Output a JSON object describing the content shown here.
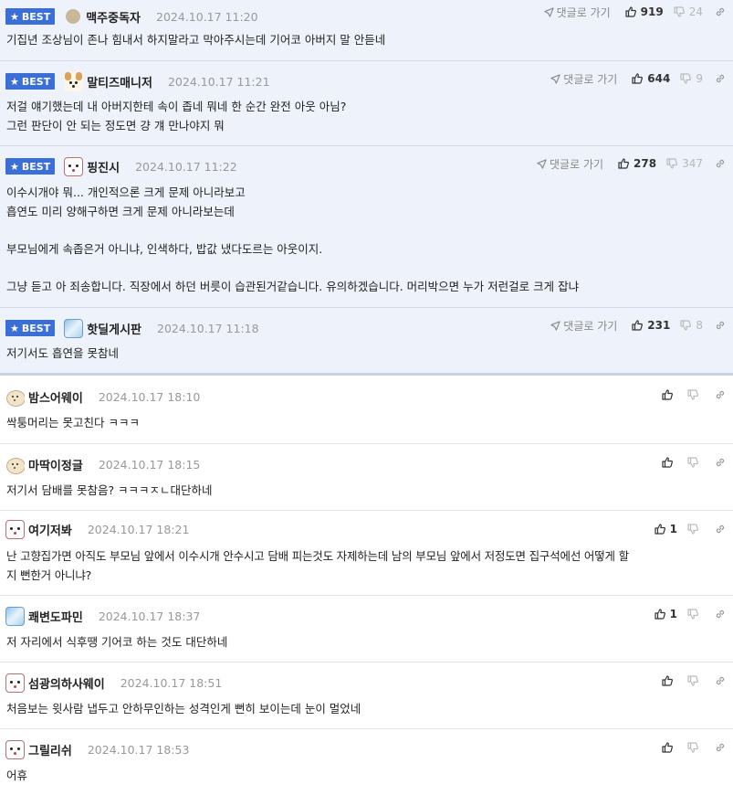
{
  "goto_label": "댓글로 가기",
  "best_label": "BEST",
  "colors": {
    "best_badge": "#3b6fd6",
    "best_bg": "#eef2fb",
    "divider": "#dfe3ec"
  },
  "best_comments": [
    {
      "nick": "맥주중독자",
      "date": "2024.10.17 11:20",
      "likes": "919",
      "dislikes": "24",
      "avatar": "circle-avatar",
      "body": "기집년 조상님이 존나 힘내서 하지말라고 막아주시는데 기어코 아버지 말 안듣네"
    },
    {
      "nick": "말티즈매니저",
      "date": "2024.10.17 11:21",
      "likes": "644",
      "dislikes": "9",
      "avatar": "maltese-avatar",
      "body": "저걸 얘기했는데 내 아버지한테 속이 좁네 뭐네 한 순간 완전 아웃 아님?\n그런 판단이 안 되는 정도면 걍 걔 만나야지 뭐"
    },
    {
      "nick": "핑진시",
      "date": "2024.10.17 11:22",
      "likes": "278",
      "dislikes": "347",
      "avatar": "dog-avatar",
      "body": "이수시개야 뭐... 개인적으론 크게 문제 아니라보고\n흡연도 미리 양해구하면 크게 문제 아니라보는데\n\n부모님에게 속좁은거 아니냐, 인색하다, 밥값 냈다도르는 아웃이지.\n\n그냥 듣고 아 죄송합니다. 직장에서 하던 버릇이 습관된거같습니다. 유의하겠습니다. 머리박으면 누가 저런걸로 크게 잡냐"
    },
    {
      "nick": "핫딜게시판",
      "date": "2024.10.17 11:18",
      "likes": "231",
      "dislikes": "8",
      "avatar": "ice-avatar",
      "body": "저기서도 흡연을 못참네"
    }
  ],
  "comments": [
    {
      "nick": "밤스어웨이",
      "date": "2024.10.17 18:10",
      "likes": "",
      "avatar": "puppy-avatar",
      "body": "싹퉁머리는 못고친다 ㅋㅋㅋ"
    },
    {
      "nick": "마딱이정글",
      "date": "2024.10.17 18:15",
      "likes": "",
      "avatar": "puppy-avatar",
      "body": "저기서 담배를 못참음? ㅋㅋㅋㅈㄴ대단하네"
    },
    {
      "nick": "여기저봐",
      "date": "2024.10.17 18:21",
      "likes": "1",
      "avatar": "dog-avatar",
      "body": "난 고향집가면 아직도 부모님 앞에서 이수시개 안수시고 담배 피는것도 자제하는데 남의 부모님 앞에서 저정도면 집구석에선 어떻게 할\n지 뻔한거 아니냐?"
    },
    {
      "nick": "쾌변도파민",
      "date": "2024.10.17 18:37",
      "likes": "1",
      "avatar": "ice-avatar",
      "body": "저 자리에서 식후땡 기어코 하는 것도 대단하네"
    },
    {
      "nick": "섬광의하사웨이",
      "date": "2024.10.17 18:51",
      "likes": "",
      "avatar": "dog-avatar",
      "body": "처음보는 윗사람 냅두고 안하무인하는 성격인게 뻔히 보이는데 눈이 멀었네"
    },
    {
      "nick": "그릴리쉬",
      "date": "2024.10.17 18:53",
      "likes": "",
      "avatar": "dog-avatar",
      "body": "어휴"
    }
  ]
}
